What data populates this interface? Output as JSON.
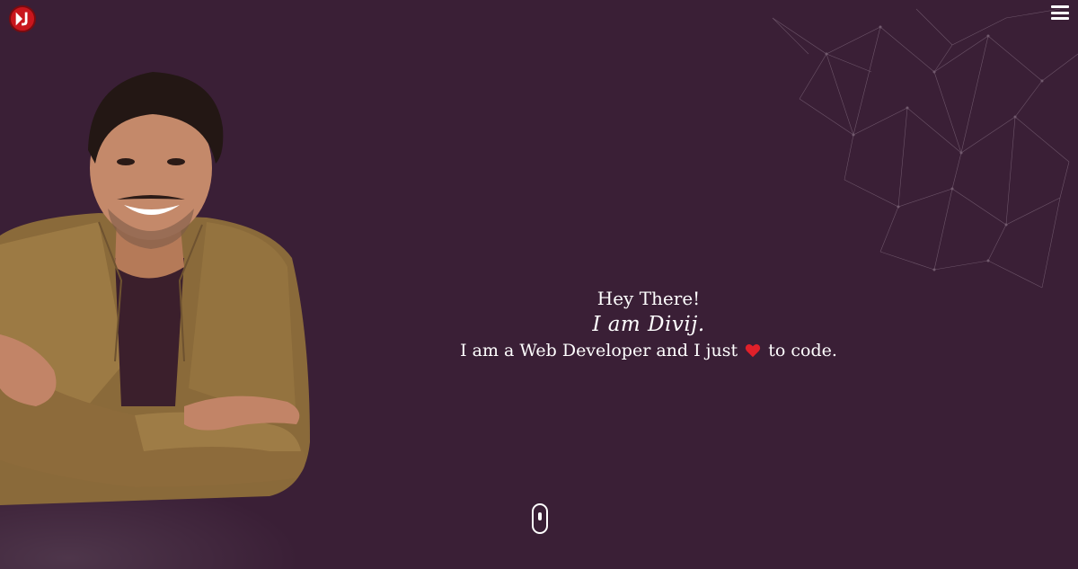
{
  "header": {
    "logo_icon": "dj-logo-icon",
    "menu_icon": "hamburger-menu-icon"
  },
  "hero": {
    "greeting": "Hey There!",
    "name": "I am Divij.",
    "tagline_before": "I am a Web Developer and I just",
    "tagline_icon": "heart-icon",
    "tagline_after": "to code."
  },
  "scroll_indicator": {
    "icon": "mouse-scroll-icon"
  },
  "colors": {
    "background": "#3a1f36",
    "text": "#ffffff",
    "logo_red": "#c8161d",
    "heart": "#e0202a"
  }
}
